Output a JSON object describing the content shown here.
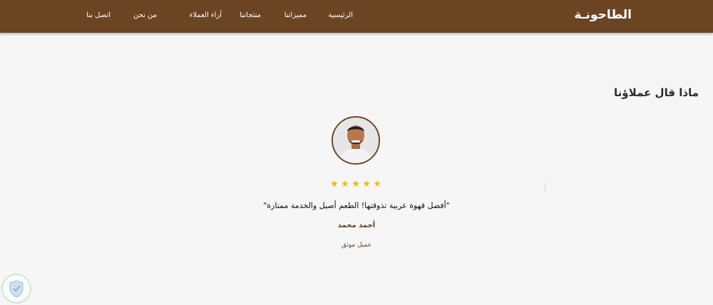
{
  "header": {
    "brand": "الطاحونـة",
    "nav": [
      "الرئيسية",
      "مميزاتنا",
      "منتجاتنا",
      "آراء العملاء",
      "من نحن",
      "اتصل بنا"
    ]
  },
  "testimonials": {
    "title": "ماذا قال عملاؤنا",
    "rating": 5,
    "quote": "\"أفضل قهوة عربية تذوقتها! الطعم أصيل والخدمة ممتازة\"",
    "author": "أحمد محمد",
    "role": "عميل موثق"
  },
  "colors": {
    "header_bg": "#6b4423",
    "page_bg": "#f6f6f6",
    "star": "#f2b705",
    "accent": "#5a3a1e"
  },
  "icons": [
    "avatar-photo",
    "star-icon",
    "shield-icon"
  ]
}
